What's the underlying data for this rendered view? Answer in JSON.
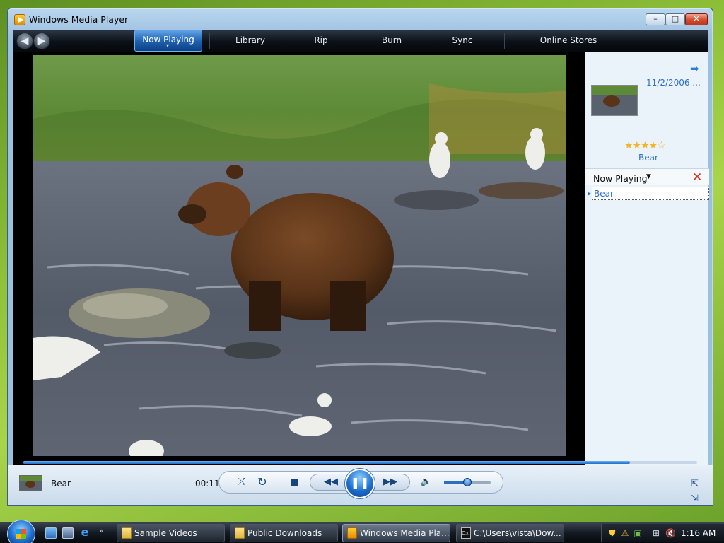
{
  "window": {
    "title": "Windows Media Player",
    "minimize_glyph": "–",
    "maximize_glyph": "□",
    "close_glyph": "✕"
  },
  "nav": {
    "back_glyph": "◀",
    "forward_glyph": "▶",
    "tabs": [
      {
        "label": "Now Playing",
        "active": true
      },
      {
        "label": "Library"
      },
      {
        "label": "Rip"
      },
      {
        "label": "Burn"
      },
      {
        "label": "Sync"
      },
      {
        "label": "Online Stores"
      }
    ]
  },
  "side_pane": {
    "forward_arrow_icon": "arrow-right-icon",
    "date": "11/2/2006 ...",
    "rating_stars": "★★★★☆",
    "rating": 4,
    "rating_max": 5,
    "media_title": "Bear",
    "list_header": "Now Playing",
    "list_dropdown_glyph": "▼",
    "clear_glyph": "✕",
    "playlist": [
      {
        "title": "Bear",
        "selected": true
      }
    ]
  },
  "player": {
    "seek_progress": 0.9,
    "now_playing_title": "Bear",
    "elapsed": "00:11",
    "shuffle_glyph": "⤭",
    "repeat_glyph": "↻",
    "prev_glyph": "◀◀",
    "play_pause_glyph": "❚❚",
    "next_glyph": "▶▶",
    "volume_glyph": "🔈",
    "volume_level": 0.5,
    "fullscreen_glyph": "⇱",
    "compact_glyph": "⇲"
  },
  "taskbar": {
    "ie_glyph": "e",
    "more_glyph": "»",
    "buttons": [
      {
        "label": "Sample Videos",
        "icon": "folder-icon"
      },
      {
        "label": "Public Downloads",
        "icon": "folder-icon"
      },
      {
        "label": "Windows Media Pla...",
        "icon": "wmp-icon",
        "active": true
      },
      {
        "label": "C:\\Users\\vista\\Dow...",
        "icon": "cmd-icon"
      }
    ],
    "cmd_glyph": "C:\\",
    "tray": {
      "shield_glyph": "⛊",
      "warning_glyph": "⚠",
      "mgmt_glyph": "▣",
      "network_glyph": "⊞",
      "volume_glyph": "🔇",
      "clock": "1:16 AM"
    }
  },
  "colors": {
    "accent": "#1f6ecf",
    "link": "#2e6fc7",
    "clear_red": "#d62a1c",
    "star_gold": "#f2b52a"
  }
}
